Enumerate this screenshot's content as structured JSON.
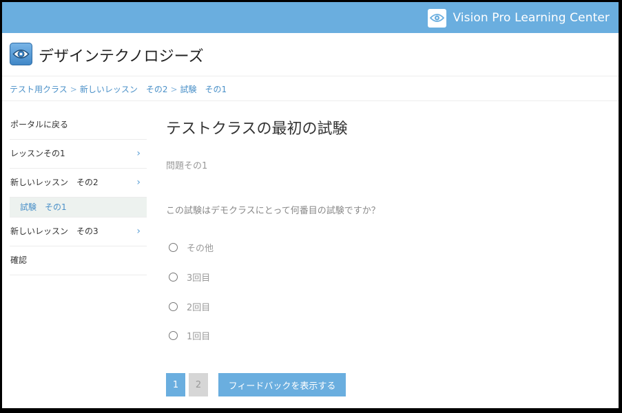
{
  "topbar": {
    "brand": "Vision Pro Learning Center",
    "icon": "eye-icon"
  },
  "header": {
    "title": "デザインテクノロジーズ",
    "icon": "eye-icon"
  },
  "breadcrumb": [
    "テスト用クラス",
    "新しいレッスン　その2",
    "試験　その1"
  ],
  "breadcrumb_separator": ">",
  "sidebar": {
    "back": "ポータルに戻る",
    "items": [
      {
        "label": "レッスンその1",
        "has_chevron": true
      },
      {
        "label": "新しいレッスン　その2",
        "has_chevron": true
      },
      {
        "label": "新しいレッスン　その3",
        "has_chevron": true
      },
      {
        "label": "確認",
        "has_chevron": false
      }
    ],
    "sub_item": "試験　その1",
    "chevron": "›"
  },
  "main": {
    "title": "テストクラスの最初の試験",
    "question_number": "問題その1",
    "question_text": "この試験はデモクラスにとって何番目の試験ですか？",
    "options": [
      "その他",
      "3回目",
      "2回目",
      "1回目"
    ],
    "pages": [
      "1",
      "2"
    ],
    "current_page": "1",
    "feedback_button": "フィードバックを表示する"
  },
  "colors": {
    "accent": "#6aaedf",
    "link": "#4a90c8",
    "active_sub_bg": "#edf2ef",
    "inactive_page": "#d6d6d6"
  }
}
